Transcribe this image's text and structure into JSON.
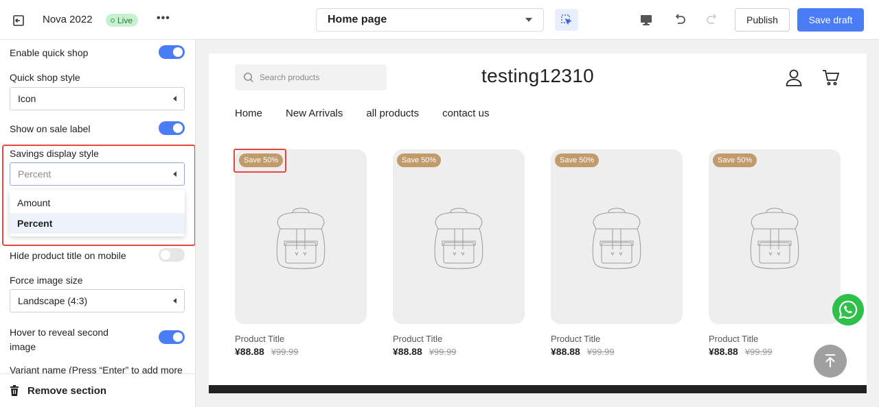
{
  "topbar": {
    "theme_name": "Nova 2022",
    "live_label": "Live",
    "more_label": "•••",
    "page_select_value": "Home page",
    "publish_label": "Publish",
    "save_label": "Save draft"
  },
  "sidebar": {
    "enable_quick_shop": {
      "label": "Enable quick shop",
      "on": true
    },
    "quick_shop_style": {
      "label": "Quick shop style",
      "value": "Icon"
    },
    "show_on_sale_label": {
      "label": "Show on sale label",
      "on": true
    },
    "savings_display_style": {
      "label": "Savings display style",
      "value": "Percent",
      "options": [
        "Amount",
        "Percent"
      ],
      "selected": "Percent"
    },
    "hide_title_mobile": {
      "label": "Hide product title on mobile",
      "on": false
    },
    "force_image_size": {
      "label": "Force image size",
      "value": "Landscape (4:3)"
    },
    "hover_second_image": {
      "label_line1": "Hover to reveal second",
      "label_line2": "image",
      "on": true
    },
    "variant_name_label": "Variant name (Press “Enter” to add more",
    "remove_section_label": "Remove section"
  },
  "preview": {
    "search_placeholder": "Search products",
    "store_title": "testing12310",
    "nav": [
      "Home",
      "New Arrivals",
      "all products",
      "contact us"
    ],
    "products": [
      {
        "badge": "Save 50%",
        "title": "Product Title",
        "price": "¥88.88",
        "compare": "¥99.99"
      },
      {
        "badge": "Save 50%",
        "title": "Product Title",
        "price": "¥88.88",
        "compare": "¥99.99"
      },
      {
        "badge": "Save 50%",
        "title": "Product Title",
        "price": "¥88.88",
        "compare": "¥99.99"
      },
      {
        "badge": "Save 50%",
        "title": "Product Title",
        "price": "¥88.88",
        "compare": "¥99.99"
      }
    ]
  },
  "colors": {
    "accent": "#4a7cf5",
    "highlight": "#e8453c",
    "badge": "#c19c6a",
    "whatsapp": "#2fc04a"
  }
}
